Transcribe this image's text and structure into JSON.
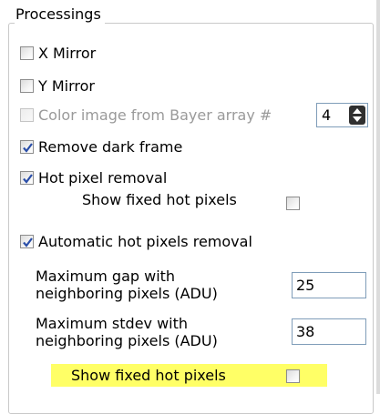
{
  "group_title": "Processings",
  "x_mirror": {
    "label": "X Mirror",
    "checked": false
  },
  "y_mirror": {
    "label": "Y Mirror",
    "checked": false
  },
  "bayer": {
    "label": "Color image from Bayer array #",
    "checked": false,
    "enabled": false,
    "value": "4"
  },
  "remove_dark_frame": {
    "label": "Remove dark frame",
    "checked": true
  },
  "hot_pixel_removal": {
    "label": "Hot pixel removal",
    "checked": true
  },
  "show_fixed_hot_pixels_1": {
    "label": "Show fixed hot pixels",
    "checked": false
  },
  "auto_hot_pixels": {
    "label": "Automatic hot pixels removal",
    "checked": true
  },
  "max_gap": {
    "line1": "Maximum gap with",
    "line2": "neighboring pixels (ADU)",
    "value": "25"
  },
  "max_stdev": {
    "line1": "Maximum stdev with",
    "line2": "neighboring pixels (ADU)",
    "value": "38"
  },
  "show_fixed_hot_pixels_2": {
    "label": "Show fixed hot pixels",
    "checked": false
  },
  "colors": {
    "check_mark": "#2a4ea8",
    "highlight": "#ffff66",
    "input_border": "#7f9db9"
  }
}
